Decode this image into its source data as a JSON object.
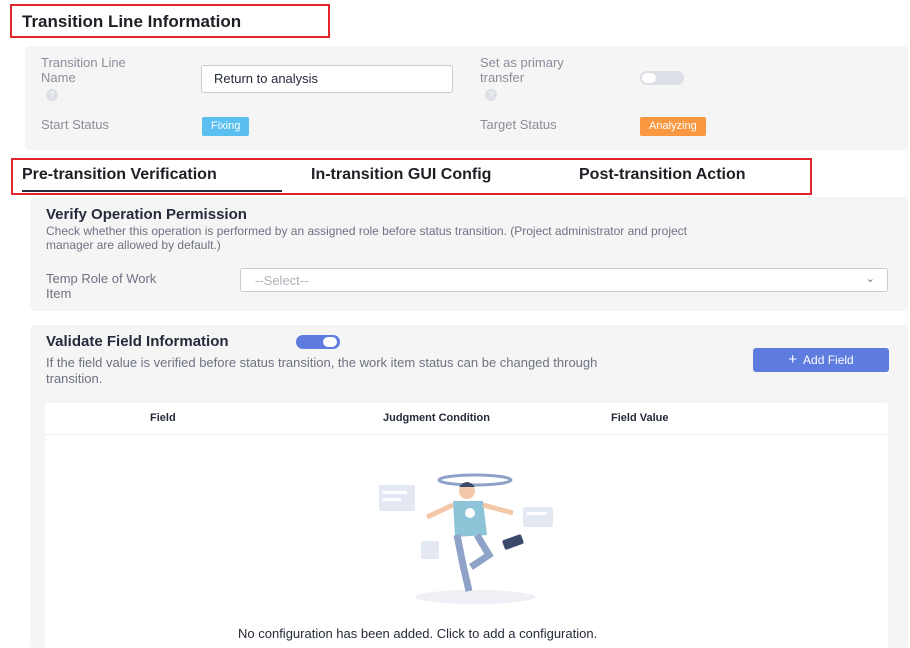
{
  "header": {
    "title": "Transition Line Information"
  },
  "info": {
    "name_label_line1": "Transition Line",
    "name_label_line2": "Name",
    "name_value": "Return to analysis",
    "primary_label_line1": "Set as primary",
    "primary_label_line2": "transfer",
    "primary_enabled": false,
    "start_label": "Start Status",
    "start_value": "Fixing",
    "start_color": "#5bc0f0",
    "target_label": "Target Status",
    "target_value": "Analyzing",
    "target_color": "#fa9841"
  },
  "tabs": [
    {
      "label": "Pre-transition Verification",
      "active": true
    },
    {
      "label": "In-transition GUI Config",
      "active": false
    },
    {
      "label": "Post-transition Action",
      "active": false
    }
  ],
  "permission": {
    "title": "Verify Operation Permission",
    "desc_line1": "Check whether this operation is performed by an assigned role before status transition. (Project administrator and project",
    "desc_line2": "manager are allowed by default.)",
    "role_label_line1": "Temp Role of Work",
    "role_label_line2": "Item",
    "select_placeholder": "--Select--"
  },
  "validate": {
    "title": "Validate Field Information",
    "enabled": true,
    "desc_line1": "If the field value is verified before status transition, the work item status can be changed through",
    "desc_line2": "transition.",
    "add_button": "Add Field",
    "columns": [
      "Field",
      "Judgment Condition",
      "Field Value"
    ],
    "empty_text": "No configuration has been added. Click to add a configuration."
  },
  "colors": {
    "accent": "#5e7ce0",
    "highlight_border": "#e0262a"
  }
}
